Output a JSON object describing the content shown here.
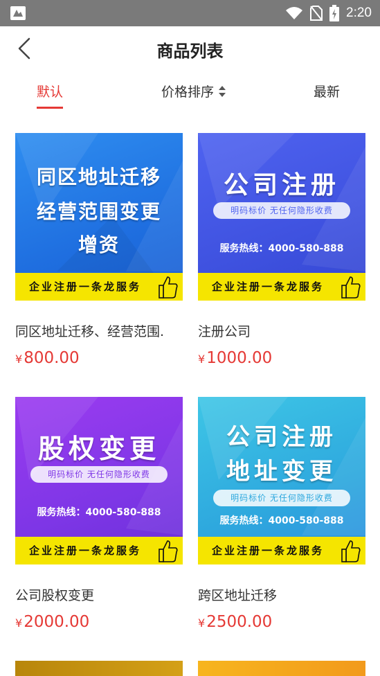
{
  "status_bar": {
    "time": "2:20"
  },
  "nav": {
    "title": "商品列表"
  },
  "tabs": [
    {
      "label": "默认"
    },
    {
      "label": "价格排序"
    },
    {
      "label": "最新"
    }
  ],
  "products": [
    {
      "name": "同区地址迁移、经营范围.",
      "currency": "¥",
      "price": "800.00",
      "banner": {
        "lines": [
          "同区地址迁移",
          "经营范围变更",
          "增资"
        ],
        "pill": "",
        "hotline": "",
        "strip": "企业注册一条龙服务"
      }
    },
    {
      "name": "注册公司",
      "currency": "¥",
      "price": "1000.00",
      "banner": {
        "lines": [
          "公司注册"
        ],
        "pill": "明码标价   无任何隐形收费",
        "hotline": "服务热线：4000-580-888",
        "strip": "企业注册一条龙服务"
      }
    },
    {
      "name": "公司股权变更",
      "currency": "¥",
      "price": "2000.00",
      "banner": {
        "lines": [
          "股权变更"
        ],
        "pill": "明码标价   无任何隐形收费",
        "hotline": "服务热线：4000-580-888",
        "strip": "企业注册一条龙服务"
      }
    },
    {
      "name": "跨区地址迁移",
      "currency": "¥",
      "price": "2500.00",
      "banner": {
        "lines": [
          "公司注册",
          "地址变更"
        ],
        "pill": "明码标价   无任何隐形收费",
        "hotline": "服务热线：4000-580-888",
        "strip": "企业注册一条龙服务"
      }
    }
  ],
  "colors": {
    "accent": "#e53935",
    "status_bar": "#7a7a7a",
    "strip_yellow": "#f5e500"
  }
}
